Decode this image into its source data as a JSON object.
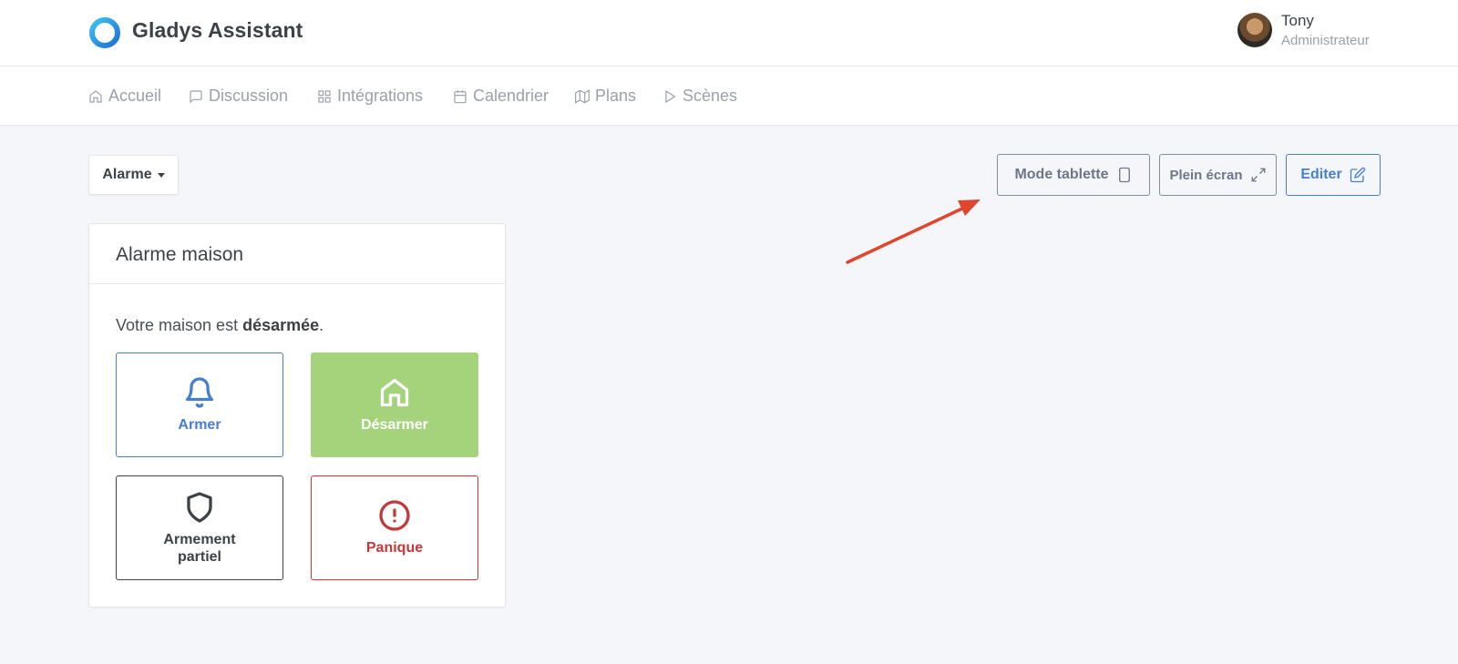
{
  "header": {
    "app_title": "Gladys Assistant",
    "user": {
      "name": "Tony",
      "role": "Administrateur"
    }
  },
  "nav": {
    "items": [
      {
        "label": "Accueil",
        "icon": "home-icon"
      },
      {
        "label": "Discussion",
        "icon": "message-square-icon"
      },
      {
        "label": "Intégrations",
        "icon": "grid-icon"
      },
      {
        "label": "Calendrier",
        "icon": "calendar-icon"
      },
      {
        "label": "Plans",
        "icon": "map-icon"
      },
      {
        "label": "Scènes",
        "icon": "play-icon"
      }
    ]
  },
  "toolbar": {
    "dashboard_select": "Alarme",
    "tablet_mode_label": "Mode tablette",
    "fullscreen_label": "Plein écran",
    "edit_label": "Editer"
  },
  "alarm_card": {
    "title": "Alarme maison",
    "status_prefix": "Votre maison est ",
    "status_value": "désarmée",
    "status_suffix": ".",
    "buttons": [
      {
        "label": "Armer",
        "icon": "bell-icon",
        "color": "#467fcf"
      },
      {
        "label": "Désarmer",
        "icon": "home-icon",
        "color": "#a5d37b",
        "active": true
      },
      {
        "label": "Armement partiel",
        "icon": "shield-icon",
        "color": "#3d4148"
      },
      {
        "label": "Panique",
        "icon": "alert-circle-icon",
        "color": "#c13a3a"
      }
    ]
  },
  "colors": {
    "primary": "#467fcf",
    "success": "#a5d37b",
    "danger": "#c13a3a",
    "annotation_arrow": "#e0452e",
    "background": "#f4f6fa"
  }
}
